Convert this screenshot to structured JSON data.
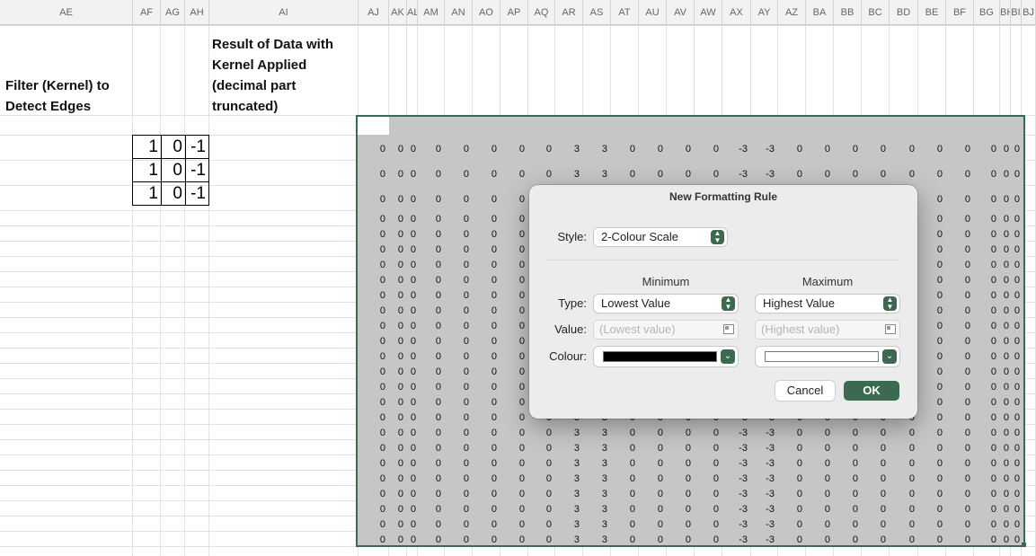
{
  "columns": [
    "AE",
    "AF",
    "AG",
    "AH",
    "AI",
    "AJ",
    "AK",
    "AL",
    "AM",
    "AN",
    "AO",
    "AP",
    "AQ",
    "AR",
    "AS",
    "AT",
    "AU",
    "AV",
    "AW",
    "AX",
    "AY",
    "AZ",
    "BA",
    "BB",
    "BC",
    "BD",
    "BE",
    "BF",
    "BG",
    "BH",
    "BI",
    "BJ"
  ],
  "left_labels": {
    "filter_line1": "Filter (Kernel) to",
    "filter_line2": "Detect Edges",
    "result_line1": "Result of Data with",
    "result_line2": "Kernel Applied",
    "result_line3": "(decimal part",
    "result_line4": "truncated)"
  },
  "kernel": [
    [
      "1",
      "0",
      "-1"
    ],
    [
      "1",
      "0",
      "-1"
    ],
    [
      "1",
      "0",
      "-1"
    ]
  ],
  "grid_row_pattern": [
    "0",
    "0",
    "0",
    "0",
    "0",
    "0",
    "0",
    "0",
    "3",
    "3",
    "0",
    "0",
    "0",
    "0",
    "-3",
    "-3",
    "0",
    "0",
    "0",
    "0",
    "0",
    "0",
    "0",
    "0",
    "0",
    "0"
  ],
  "dialog": {
    "title": "New Formatting Rule",
    "style_label": "Style:",
    "style_value": "2-Colour Scale",
    "minimum_header": "Minimum",
    "maximum_header": "Maximum",
    "type_label": "Type:",
    "value_label": "Value:",
    "colour_label": "Colour:",
    "min_type": "Lowest Value",
    "max_type": "Highest Value",
    "min_value_placeholder": "(Lowest value)",
    "max_value_placeholder": "(Highest value)",
    "min_colour": "#000000",
    "max_colour": "#ffffff",
    "cancel_label": "Cancel",
    "ok_label": "OK",
    "accent_color": "#3c6a50"
  }
}
